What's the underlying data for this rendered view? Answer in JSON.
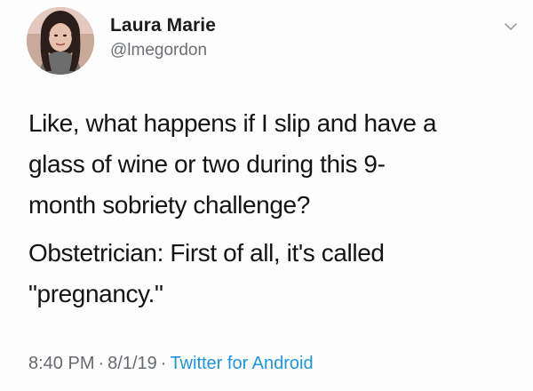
{
  "user": {
    "display_name": "Laura Marie",
    "handle": "@lmegordon"
  },
  "tweet": {
    "paragraphs": [
      "Like, what happens if I slip and have a\nglass of wine or two during this 9-\nmonth sobriety challenge?",
      "Obstetrician: First of all, it's called\n\"pregnancy.\""
    ],
    "time": "8:40 PM",
    "date": "8/1/19",
    "source": "Twitter for Android",
    "separator": "·"
  },
  "icons": {
    "menu": "chevron-down-icon",
    "avatar": "avatar"
  },
  "colors": {
    "link": "#1b95e0",
    "secondary_text": "#666a6e"
  }
}
